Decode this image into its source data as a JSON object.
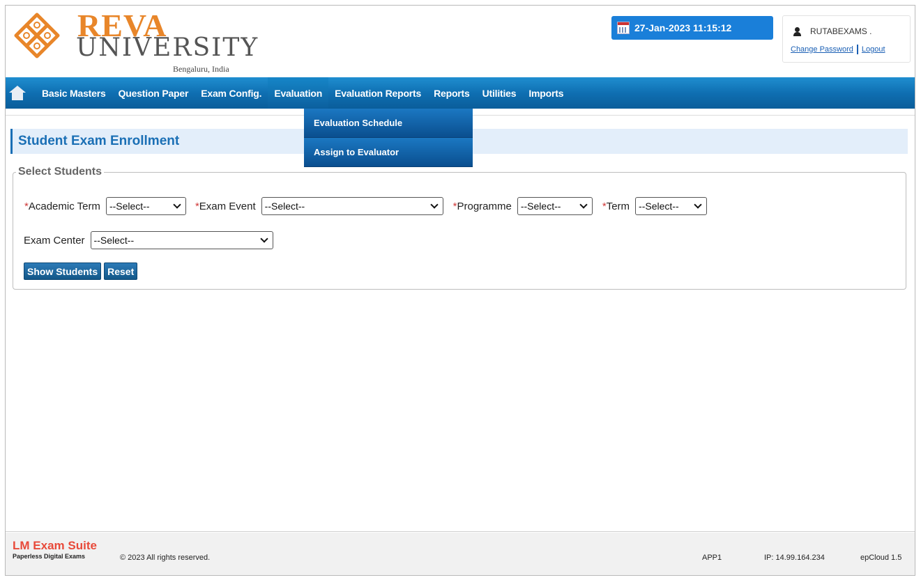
{
  "header": {
    "brand_line1": "REVA",
    "brand_line2": "UNIVERSITY",
    "brand_line3": "Bengaluru, India",
    "logo_icon": "reva-knot-logo",
    "datetime": "27-Jan-2023 11:15:12",
    "username": "RUTABEXAMS .",
    "change_password": "Change Password",
    "logout": "Logout"
  },
  "nav": {
    "items": [
      {
        "label": "Basic Masters"
      },
      {
        "label": "Question Paper"
      },
      {
        "label": "Exam Config."
      },
      {
        "label": "Evaluation"
      },
      {
        "label": "Evaluation Reports"
      },
      {
        "label": "Reports"
      },
      {
        "label": "Utilities"
      },
      {
        "label": "Imports"
      }
    ],
    "active": "Evaluation",
    "dropdown": [
      {
        "label": "Evaluation Schedule"
      },
      {
        "label": "Assign to Evaluator"
      }
    ]
  },
  "page": {
    "title": "Student Exam Enrollment",
    "section_title": "Select Students",
    "required_mark": "*",
    "fields": {
      "academic_term": {
        "label": "Academic Term",
        "value": "--Select--"
      },
      "exam_event": {
        "label": "Exam Event",
        "value": "--Select--"
      },
      "programme": {
        "label": "Programme",
        "value": "--Select--"
      },
      "term": {
        "label": "Term",
        "value": "--Select--"
      },
      "exam_center": {
        "label": "Exam Center",
        "value": "--Select--"
      }
    },
    "buttons": {
      "show_students": "Show Students",
      "reset": "Reset"
    }
  },
  "footer": {
    "brand_prefix": "LM",
    "brand_name": "Exam Suite",
    "tagline": "Paperless Digital Exams",
    "copyright": "© 2023 All rights reserved.",
    "app": "APP1",
    "ip": "IP: 14.99.164.234",
    "version": "epCloud 1.5"
  },
  "colors": {
    "brand_orange": "#e8862a",
    "nav_blue": "#0f6fb2",
    "title_blue": "#1a6fb5",
    "required_red": "#d03a3a"
  }
}
